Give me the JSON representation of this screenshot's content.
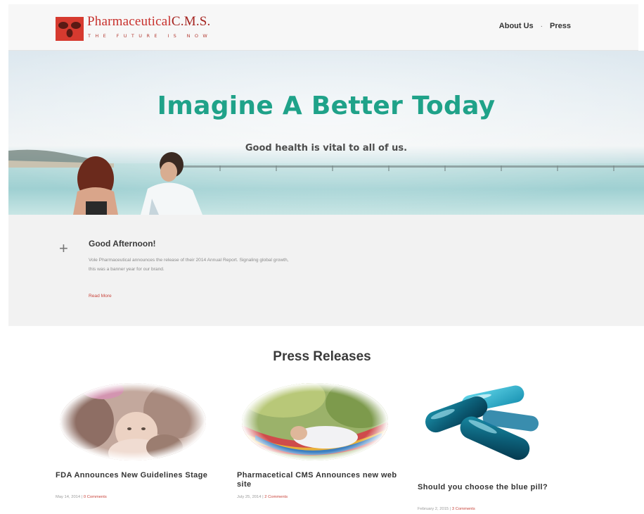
{
  "brand": {
    "name": "Pharmaceutical",
    "name_suffix": "C.M.S.",
    "tagline": "THE FUTURE IS NOW",
    "logo_color": "#c8302c"
  },
  "nav": {
    "items": [
      {
        "label": "About Us"
      },
      {
        "label": "Press"
      }
    ],
    "separator": "·"
  },
  "hero": {
    "title": "Imagine A Better Today",
    "subtitle": "Good health is vital to all of us.",
    "title_color": "#1fa289"
  },
  "welcome": {
    "icon": "plus-icon",
    "title": "Good Afternoon!",
    "body": "Vole Pharmaceutical announces the release of their 2014 Annual Report. Signaling global growth, this was a banner year for our brand.",
    "link": "Read More"
  },
  "press": {
    "heading": "Press Releases",
    "cards": [
      {
        "title": "FDA Announces New Guidelines Stage",
        "date": "May 14, 2014",
        "separator": "|",
        "comments": "0 Comments",
        "image": "mother-and-baby-photo"
      },
      {
        "title": "Pharmacetical CMS Announces new web site",
        "date": "July 25, 2014",
        "separator": "|",
        "comments": "2 Comments",
        "image": "woman-in-hammock-photo"
      },
      {
        "title": "Should you choose the blue pill?",
        "date": "February 2, 2015",
        "separator": "|",
        "comments": "3 Comments",
        "image": "blue-capsules-photo"
      }
    ]
  }
}
